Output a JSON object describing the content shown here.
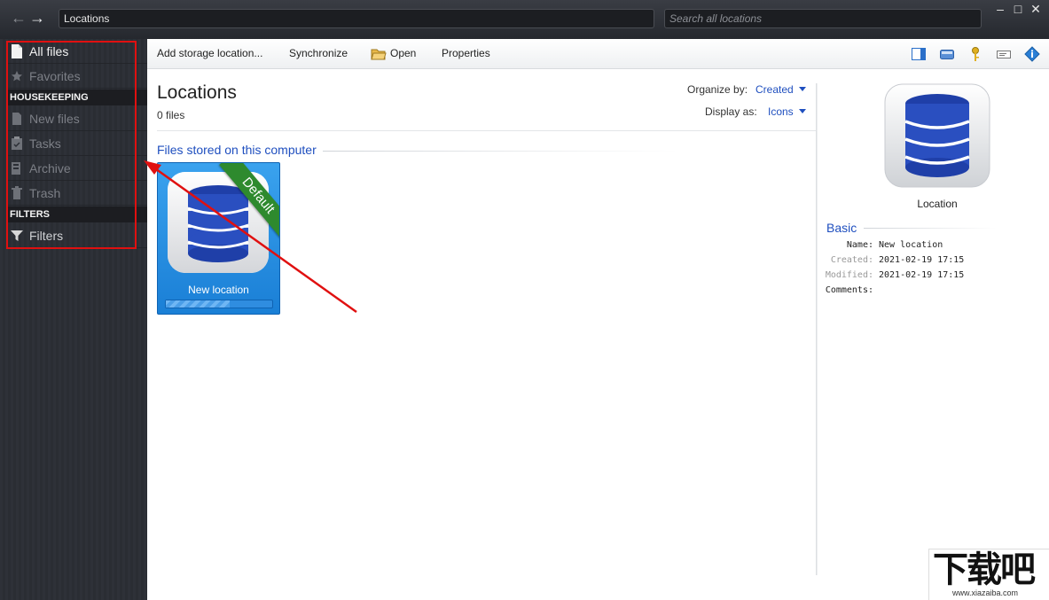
{
  "titlebar": {
    "address": "Locations",
    "search_placeholder": "Search all locations",
    "back_icon": "arrow-left-icon",
    "forward_icon": "arrow-right-icon",
    "window_controls": [
      "minimize",
      "maximize",
      "close"
    ]
  },
  "sidebar": {
    "items": [
      {
        "label": "All files",
        "icon": "file-icon",
        "active": true
      },
      {
        "label": "Favorites",
        "icon": "star-icon"
      }
    ],
    "housekeeping_header": "HOUSEKEEPING",
    "housekeeping": [
      {
        "label": "New files",
        "icon": "new-files-icon"
      },
      {
        "label": "Tasks",
        "icon": "clipboard-icon"
      },
      {
        "label": "Archive",
        "icon": "archive-icon"
      },
      {
        "label": "Trash",
        "icon": "trash-icon"
      }
    ],
    "filters_header": "FILTERS",
    "filters": [
      {
        "label": "Filters",
        "icon": "funnel-icon"
      }
    ]
  },
  "toolbar": {
    "add_storage": "Add storage location...",
    "synchronize": "Synchronize",
    "open": "Open",
    "properties": "Properties",
    "right_icons": [
      "panel-icon",
      "drive-icon",
      "key-icon",
      "tag-icon",
      "info-icon"
    ]
  },
  "main": {
    "title": "Locations",
    "count": "0 files",
    "organize_label": "Organize by:",
    "organize_value": "Created",
    "display_label": "Display as:",
    "display_value": "Icons",
    "section_title": "Files stored on this computer",
    "tile": {
      "label": "New location",
      "ribbon": "Default",
      "progress": 0.6
    }
  },
  "details": {
    "title": "Location",
    "section": "Basic",
    "props": [
      {
        "label": "Name:",
        "value": "New location"
      },
      {
        "label": "Created:",
        "value": "2021-02-19 17:15"
      },
      {
        "label": "Modified:",
        "value": "2021-02-19 17:15"
      },
      {
        "label": "Comments:",
        "value": ""
      }
    ]
  },
  "watermark": {
    "text": "下载吧",
    "url": "www.xiazaiba.com"
  },
  "colors": {
    "accent_blue": "#1f4fbf",
    "tile_blue": "#2a90e4",
    "annotation_red": "#e01010",
    "ribbon_green": "#2e8a2e"
  }
}
